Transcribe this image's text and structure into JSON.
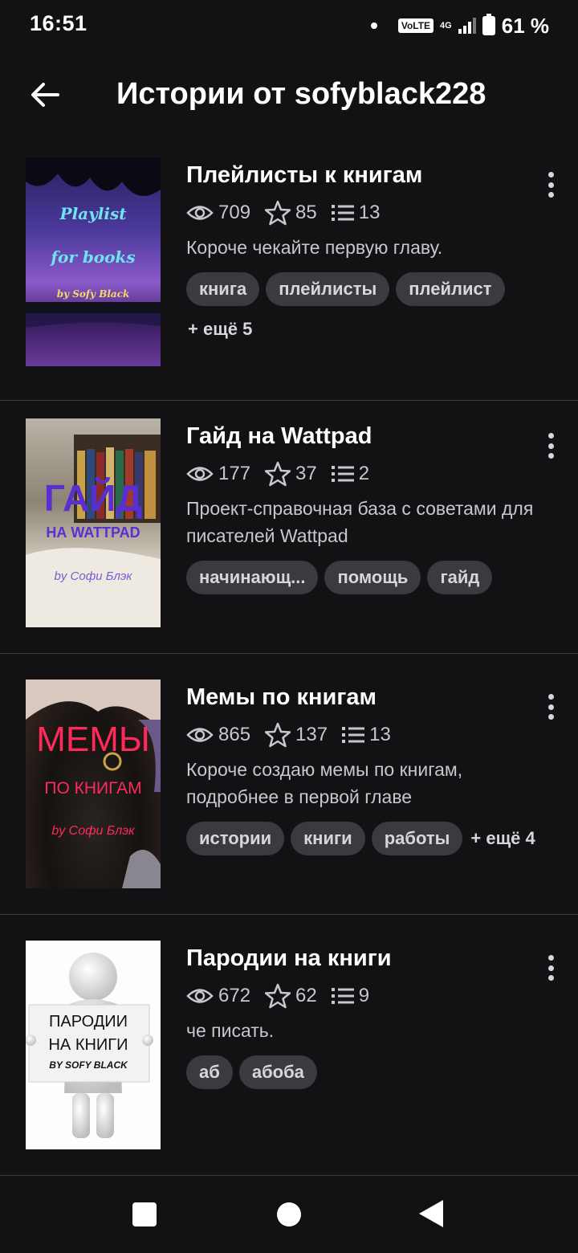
{
  "status_bar": {
    "time": "16:51",
    "volte": "VoLTE",
    "network": "4G",
    "battery": "61 %"
  },
  "header": {
    "title": "Истории от sofyblack228"
  },
  "stories": [
    {
      "title": "Плейлисты к книгам",
      "views": "709",
      "votes": "85",
      "parts": "13",
      "description": "Короче чекайте первую главу.",
      "tags": [
        "книга",
        "плейлисты",
        "плейлист"
      ],
      "more": "+ ещё 5",
      "cover": {
        "line1": "Playlist",
        "line2": "for books",
        "line3": "by Sofy Black"
      }
    },
    {
      "title": "Гайд на Wattpad",
      "views": "177",
      "votes": "37",
      "parts": "2",
      "description": "Проект-справочная база с советами для писателей Wattpad",
      "tags": [
        "начинающ...",
        "помощь",
        "гайд"
      ],
      "more": "",
      "cover": {
        "line1": "ГАЙД",
        "line2": "НА WATTPAD",
        "line3": "by Софи Блэк"
      }
    },
    {
      "title": "Мемы по книгам",
      "views": "865",
      "votes": "137",
      "parts": "13",
      "description": "Короче создаю мемы по книгам, подробнее в первой главе",
      "tags": [
        "истории",
        "книги",
        "работы"
      ],
      "more": "+ ещё 4",
      "cover": {
        "line1": "МЕМЫ",
        "line2": "ПО КНИГАМ",
        "line3": "by Софи Блэк"
      }
    },
    {
      "title": "Пародии на книги",
      "views": "672",
      "votes": "62",
      "parts": "9",
      "description": "че писать.",
      "tags": [
        "аб",
        "абоба"
      ],
      "more": "",
      "cover": {
        "line1": "ПАРОДИИ",
        "line2": "НА КНИГИ",
        "line3": "BY SOFY BLACK"
      }
    }
  ]
}
